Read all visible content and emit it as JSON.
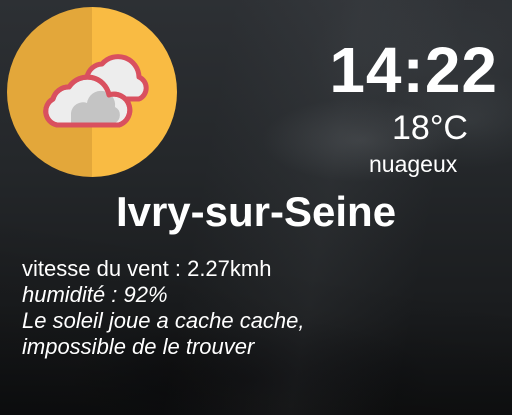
{
  "weather": {
    "time": "14:22",
    "temperature": "18°C",
    "condition": "nuageux",
    "city": "Ivry-sur-Seine",
    "wind": "vitesse du vent : 2.27kmh",
    "humidity": "humidité : 92%",
    "message_line1": "Le soleil joue a cache cache,",
    "message_line2": "impossible de le trouver",
    "icon": "cloudy-icon"
  },
  "colors": {
    "icon_circle_left": "#e3a73a",
    "icon_circle_right": "#f9bb43",
    "cloud_outline": "#d9505f",
    "cloud_fill_light": "#ededed",
    "cloud_fill_shade": "#bdbdbd",
    "text": "#ffffff"
  }
}
